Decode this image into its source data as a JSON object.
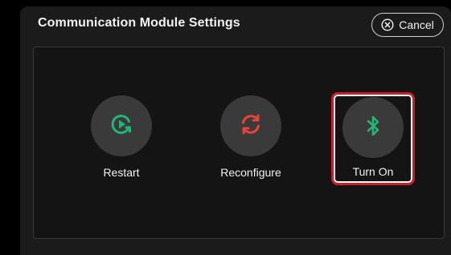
{
  "dialog": {
    "title": "Communication Module Settings",
    "cancel_label": "Cancel"
  },
  "actions": [
    {
      "label": "Restart",
      "icon": "restart-icon",
      "color": "#22b573"
    },
    {
      "label": "Reconfigure",
      "icon": "reconfigure-icon",
      "color": "#e8423a"
    },
    {
      "label": "Turn On",
      "icon": "bluetooth-icon",
      "color": "#22b573",
      "selected": true
    }
  ],
  "colors": {
    "dialog_bg": "#1b1b1b",
    "panel_bg": "#141414",
    "icon_circle_bg": "#3a3a3a",
    "selection_border": "#c91f2b",
    "green_accent": "#22b573",
    "red_accent": "#e8423a"
  }
}
